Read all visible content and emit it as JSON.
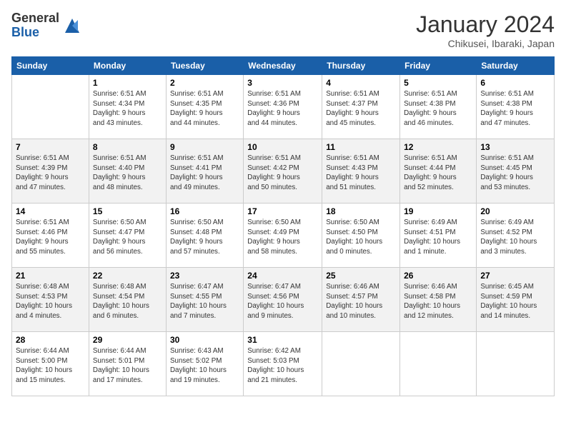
{
  "header": {
    "logo_line1": "General",
    "logo_line2": "Blue",
    "month_year": "January 2024",
    "location": "Chikusei, Ibaraki, Japan"
  },
  "weekdays": [
    "Sunday",
    "Monday",
    "Tuesday",
    "Wednesday",
    "Thursday",
    "Friday",
    "Saturday"
  ],
  "weeks": [
    [
      {
        "day": "",
        "info": ""
      },
      {
        "day": "1",
        "info": "Sunrise: 6:51 AM\nSunset: 4:34 PM\nDaylight: 9 hours\nand 43 minutes."
      },
      {
        "day": "2",
        "info": "Sunrise: 6:51 AM\nSunset: 4:35 PM\nDaylight: 9 hours\nand 44 minutes."
      },
      {
        "day": "3",
        "info": "Sunrise: 6:51 AM\nSunset: 4:36 PM\nDaylight: 9 hours\nand 44 minutes."
      },
      {
        "day": "4",
        "info": "Sunrise: 6:51 AM\nSunset: 4:37 PM\nDaylight: 9 hours\nand 45 minutes."
      },
      {
        "day": "5",
        "info": "Sunrise: 6:51 AM\nSunset: 4:38 PM\nDaylight: 9 hours\nand 46 minutes."
      },
      {
        "day": "6",
        "info": "Sunrise: 6:51 AM\nSunset: 4:38 PM\nDaylight: 9 hours\nand 47 minutes."
      }
    ],
    [
      {
        "day": "7",
        "info": "Sunrise: 6:51 AM\nSunset: 4:39 PM\nDaylight: 9 hours\nand 47 minutes."
      },
      {
        "day": "8",
        "info": "Sunrise: 6:51 AM\nSunset: 4:40 PM\nDaylight: 9 hours\nand 48 minutes."
      },
      {
        "day": "9",
        "info": "Sunrise: 6:51 AM\nSunset: 4:41 PM\nDaylight: 9 hours\nand 49 minutes."
      },
      {
        "day": "10",
        "info": "Sunrise: 6:51 AM\nSunset: 4:42 PM\nDaylight: 9 hours\nand 50 minutes."
      },
      {
        "day": "11",
        "info": "Sunrise: 6:51 AM\nSunset: 4:43 PM\nDaylight: 9 hours\nand 51 minutes."
      },
      {
        "day": "12",
        "info": "Sunrise: 6:51 AM\nSunset: 4:44 PM\nDaylight: 9 hours\nand 52 minutes."
      },
      {
        "day": "13",
        "info": "Sunrise: 6:51 AM\nSunset: 4:45 PM\nDaylight: 9 hours\nand 53 minutes."
      }
    ],
    [
      {
        "day": "14",
        "info": "Sunrise: 6:51 AM\nSunset: 4:46 PM\nDaylight: 9 hours\nand 55 minutes."
      },
      {
        "day": "15",
        "info": "Sunrise: 6:50 AM\nSunset: 4:47 PM\nDaylight: 9 hours\nand 56 minutes."
      },
      {
        "day": "16",
        "info": "Sunrise: 6:50 AM\nSunset: 4:48 PM\nDaylight: 9 hours\nand 57 minutes."
      },
      {
        "day": "17",
        "info": "Sunrise: 6:50 AM\nSunset: 4:49 PM\nDaylight: 9 hours\nand 58 minutes."
      },
      {
        "day": "18",
        "info": "Sunrise: 6:50 AM\nSunset: 4:50 PM\nDaylight: 10 hours\nand 0 minutes."
      },
      {
        "day": "19",
        "info": "Sunrise: 6:49 AM\nSunset: 4:51 PM\nDaylight: 10 hours\nand 1 minute."
      },
      {
        "day": "20",
        "info": "Sunrise: 6:49 AM\nSunset: 4:52 PM\nDaylight: 10 hours\nand 3 minutes."
      }
    ],
    [
      {
        "day": "21",
        "info": "Sunrise: 6:48 AM\nSunset: 4:53 PM\nDaylight: 10 hours\nand 4 minutes."
      },
      {
        "day": "22",
        "info": "Sunrise: 6:48 AM\nSunset: 4:54 PM\nDaylight: 10 hours\nand 6 minutes."
      },
      {
        "day": "23",
        "info": "Sunrise: 6:47 AM\nSunset: 4:55 PM\nDaylight: 10 hours\nand 7 minutes."
      },
      {
        "day": "24",
        "info": "Sunrise: 6:47 AM\nSunset: 4:56 PM\nDaylight: 10 hours\nand 9 minutes."
      },
      {
        "day": "25",
        "info": "Sunrise: 6:46 AM\nSunset: 4:57 PM\nDaylight: 10 hours\nand 10 minutes."
      },
      {
        "day": "26",
        "info": "Sunrise: 6:46 AM\nSunset: 4:58 PM\nDaylight: 10 hours\nand 12 minutes."
      },
      {
        "day": "27",
        "info": "Sunrise: 6:45 AM\nSunset: 4:59 PM\nDaylight: 10 hours\nand 14 minutes."
      }
    ],
    [
      {
        "day": "28",
        "info": "Sunrise: 6:44 AM\nSunset: 5:00 PM\nDaylight: 10 hours\nand 15 minutes."
      },
      {
        "day": "29",
        "info": "Sunrise: 6:44 AM\nSunset: 5:01 PM\nDaylight: 10 hours\nand 17 minutes."
      },
      {
        "day": "30",
        "info": "Sunrise: 6:43 AM\nSunset: 5:02 PM\nDaylight: 10 hours\nand 19 minutes."
      },
      {
        "day": "31",
        "info": "Sunrise: 6:42 AM\nSunset: 5:03 PM\nDaylight: 10 hours\nand 21 minutes."
      },
      {
        "day": "",
        "info": ""
      },
      {
        "day": "",
        "info": ""
      },
      {
        "day": "",
        "info": ""
      }
    ]
  ]
}
